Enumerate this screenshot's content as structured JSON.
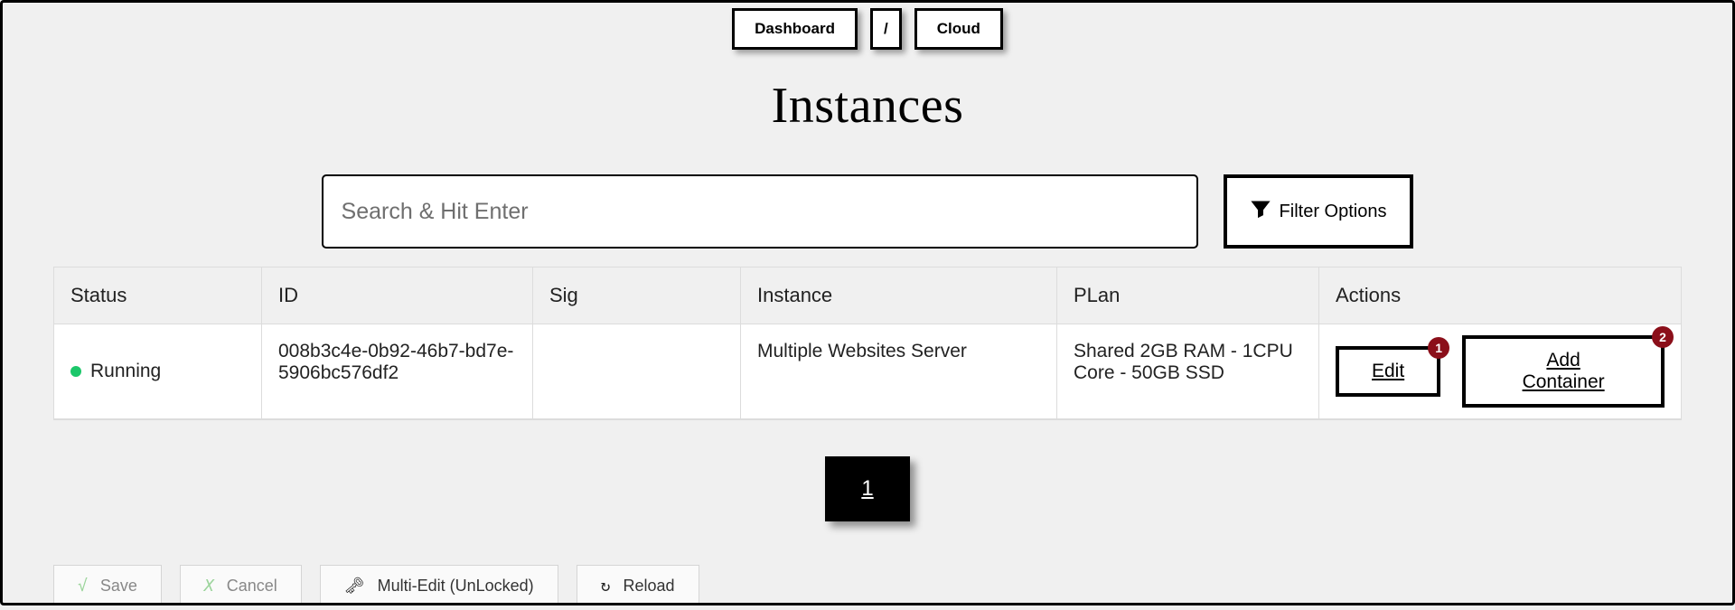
{
  "breadcrumb": {
    "items": [
      "Dashboard",
      "Cloud"
    ],
    "separator": "/"
  },
  "title": "Instances",
  "search": {
    "placeholder": "Search & Hit Enter",
    "value": ""
  },
  "filter_button": "Filter Options",
  "table": {
    "headers": [
      "Status",
      "ID",
      "Sig",
      "Instance",
      "PLan",
      "Actions"
    ],
    "rows": [
      {
        "status_label": "Running",
        "status_color": "#1cc76a",
        "id": "008b3c4e-0b92-46b7-bd7e-5906bc576df2",
        "sig": "",
        "instance": "Multiple Websites Server",
        "plan": "Shared 2GB RAM - 1CPU Core - 50GB SSD",
        "actions": {
          "edit": {
            "label": "Edit",
            "badge": "1"
          },
          "add_container": {
            "label": "Add Container",
            "badge": "2"
          }
        }
      }
    ]
  },
  "pagination": {
    "current": "1"
  },
  "bottom_bar": {
    "save": "Save",
    "cancel": "Cancel",
    "multi_edit": "Multi-Edit (UnLocked)",
    "reload": "Reload"
  }
}
